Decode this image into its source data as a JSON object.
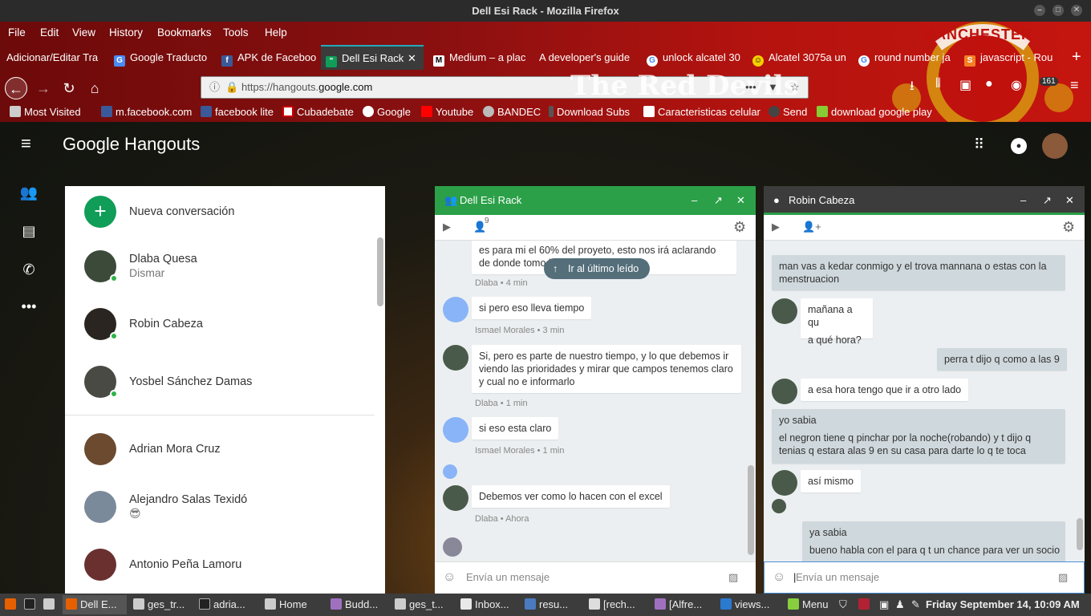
{
  "window": {
    "title": "Dell Esi Rack - Mozilla Firefox"
  },
  "menu": [
    "File",
    "Edit",
    "View",
    "History",
    "Bookmarks",
    "Tools",
    "Help"
  ],
  "tabs": [
    {
      "label": "Adicionar/Editar Tra"
    },
    {
      "label": "Google Traducto",
      "icon": "google-translate-icon"
    },
    {
      "label": "APK de Faceboo",
      "icon": "facebook-icon"
    },
    {
      "label": "Dell Esi Rack",
      "icon": "hangouts-icon",
      "active": true
    },
    {
      "label": "Medium – a plac",
      "icon": "medium-icon"
    },
    {
      "label": "A developer's guide"
    },
    {
      "label": "unlock alcatel 30",
      "icon": "google-icon"
    },
    {
      "label": "Alcatel 3075a un",
      "icon": "smiley-icon"
    },
    {
      "label": "round number ja",
      "icon": "google-icon"
    },
    {
      "label": "javascript - Rou",
      "icon": "stackoverflow-icon"
    }
  ],
  "address": {
    "url_prefix": "https://hangouts.",
    "url_domain": "google.com",
    "badge": "161",
    "theme_text": "The Red Devils",
    "theme_logo_text": "MANCHESTER"
  },
  "bookmarks": [
    "Most Visited",
    "m.facebook.com",
    "facebook lite",
    "Cubadebate",
    "Google",
    "Youtube",
    "BANDEC",
    "Download Subs",
    "Caracteristicas celular",
    "Send",
    "download google play"
  ],
  "hangouts": {
    "logo": "Google Hangouts",
    "new_conversation": "Nueva conversación",
    "conversations": [
      {
        "name": "Dlaba Quesa",
        "sub": "Dismar",
        "online": true
      },
      {
        "name": "Robin Cabeza",
        "sub": "",
        "online": true
      },
      {
        "name": "Yosbel Sánchez Damas",
        "sub": "",
        "online": true
      },
      {
        "name": "Adrian Mora Cruz",
        "sub": "",
        "online": false
      },
      {
        "name": "Alejandro Salas Texidó",
        "sub": "😎",
        "online": false
      },
      {
        "name": "Antonio Peña Lamoru",
        "sub": "",
        "online": false
      }
    ]
  },
  "chat1": {
    "title": "Dell Esi Rack",
    "participants": "9",
    "jump_label": "Ir al último leído",
    "input_placeholder": "Envía un mensaje",
    "messages": [
      {
        "text": "es para mi el 60% del proyeto, esto nos irá aclarando de donde tomo los",
        "meta": "Dlaba • 4 min"
      },
      {
        "text": "si pero eso lleva tiempo",
        "meta": "Ismael Morales • 3 min"
      },
      {
        "text": "Si, pero es parte de nuestro tiempo, y lo que debemos ir viendo las prioridades y mirar que campos tenemos claro y cual no e informarlo",
        "meta": "Dlaba • 1 min"
      },
      {
        "text": "si eso esta claro",
        "meta": "Ismael Morales • 1 min"
      },
      {
        "text": "Debemos ver como lo hacen con el excel",
        "meta": "Dlaba • Ahora"
      }
    ]
  },
  "chat2": {
    "title": "Robin Cabeza",
    "input_placeholder": "Envía un mensaje",
    "messages": [
      {
        "text": "man vas a kedar conmigo y el trova mannana o estas con la menstruacion",
        "mine": true
      },
      {
        "text": "mañana a qu",
        "mine": false
      },
      {
        "text": "a qué hora?",
        "mine": false
      },
      {
        "text": "perra t dijo q como a las 9",
        "mine": true
      },
      {
        "text": "a esa hora tengo que ir a otro lado",
        "mine": false
      },
      {
        "text": "yo sabia",
        "mine": true
      },
      {
        "text": "el negron tiene q pinchar por la noche(robando) y t dijo q tenias q estara alas 9 en su casa para darte lo q te toca",
        "mine": true
      },
      {
        "text": "así mismo",
        "mine": false
      },
      {
        "text": "ya sabia",
        "mine": true
      },
      {
        "text": "bueno habla con el para q t un chance para ver un socio",
        "mine": true
      }
    ]
  },
  "taskbar": {
    "items": [
      "Dell E...",
      "ges_tr...",
      "adria...",
      "Home",
      "Budd...",
      "ges_t...",
      "Inbox...",
      "resu...",
      "[rech...",
      "[Alfre...",
      "views..."
    ],
    "menu_label": "Menu",
    "clock": "Friday September 14, 10:09 AM"
  },
  "colors": {
    "accent_green": "#2ba048",
    "chrome_red": "#b5130f",
    "online": "#2db34a"
  }
}
